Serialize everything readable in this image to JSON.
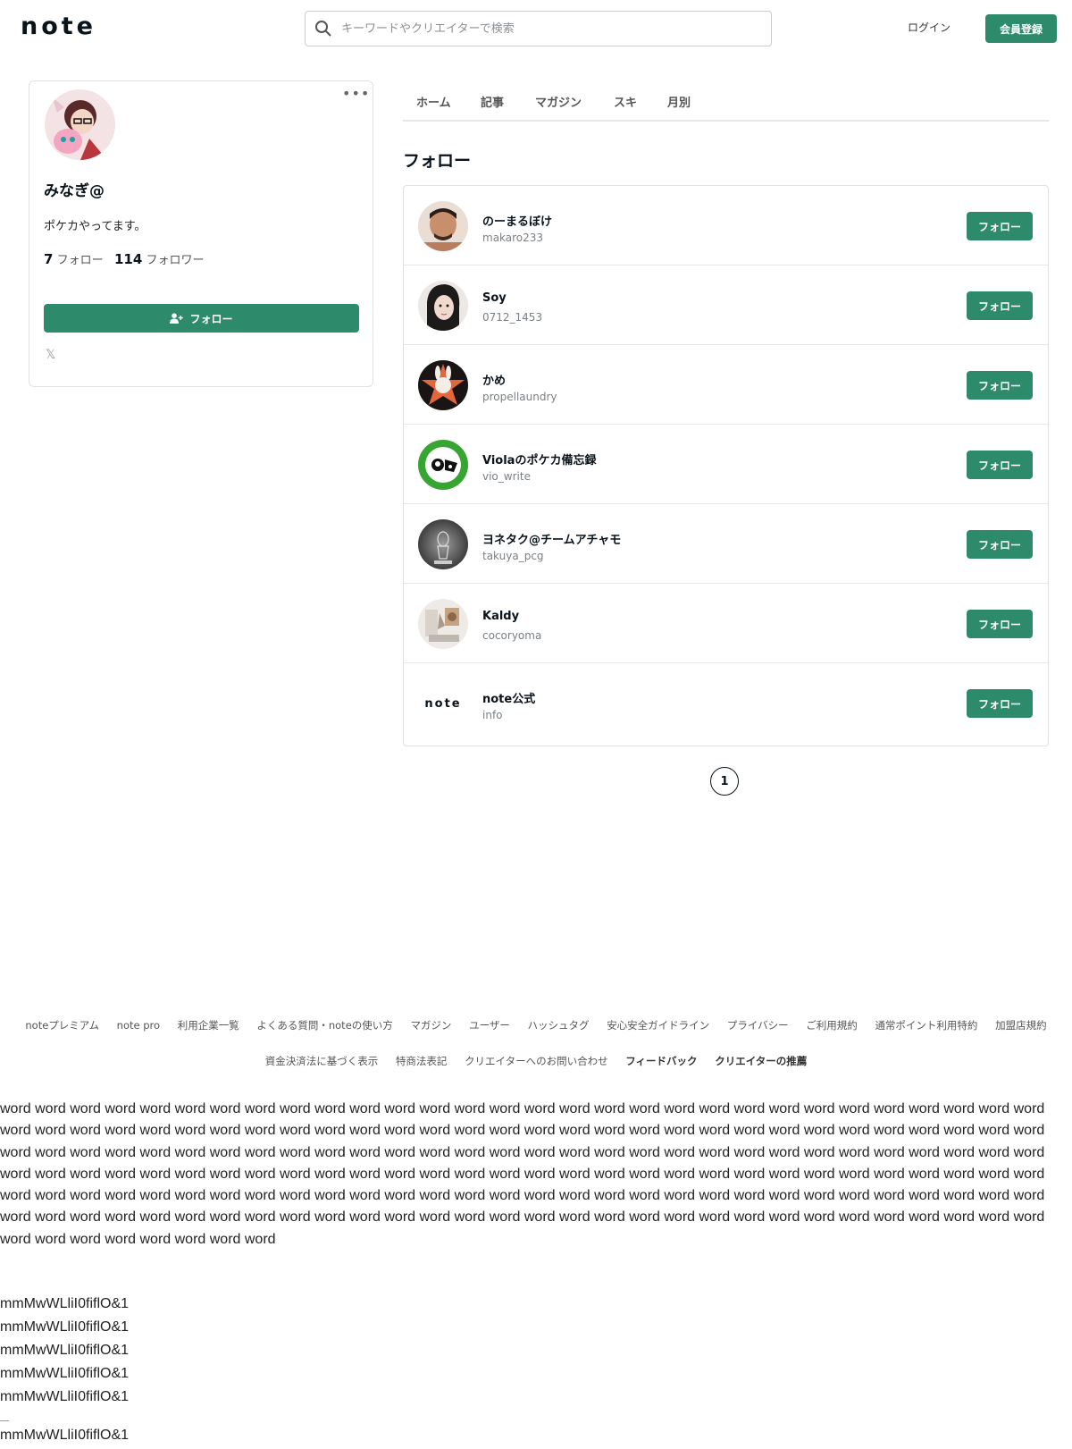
{
  "header": {
    "logo": "note",
    "search_placeholder": "キーワードやクリエイターで検索",
    "login_label": "ログイン",
    "signup_label": "会員登録"
  },
  "profile": {
    "name": "みなぎ@",
    "bio": "ポケカやってます。",
    "following_count": "7",
    "following_label": "フォロー",
    "follower_count": "114",
    "follower_label": "フォロワー",
    "follow_button": "フォロー",
    "more_label": "•••",
    "x_icon": "𝕏"
  },
  "tabs": [
    "ホーム",
    "記事",
    "マガジン",
    "スキ",
    "月別"
  ],
  "section_title": "フォロー",
  "users": [
    {
      "name": "のーまるぼけ",
      "id": "makaro233",
      "button": "フォロー"
    },
    {
      "name": "Soy",
      "id": "0712_1453",
      "button": "フォロー"
    },
    {
      "name": "かめ",
      "id": "propellaundry",
      "button": "フォロー"
    },
    {
      "name": "Violaのポケカ備忘録",
      "id": "vio_write",
      "button": "フォロー"
    },
    {
      "name": "ヨネタク@チームアチャモ",
      "id": "takuya_pcg",
      "button": "フォロー"
    },
    {
      "name": "Kaldy",
      "id": "cocoryoma",
      "button": "フォロー"
    },
    {
      "name": "note公式",
      "id": "info",
      "button": "フォロー"
    }
  ],
  "note_avatar_text": "note",
  "pagination": {
    "current": "1"
  },
  "footer": {
    "row1": [
      "noteプレミアム",
      "note pro",
      "利用企業一覧",
      "よくある質問・noteの使い方",
      "マガジン",
      "ユーザー",
      "ハッシュタグ",
      "安心安全ガイドライン",
      "プライバシー",
      "ご利用規約",
      "通常ポイント利用特約",
      "加盟店規約"
    ],
    "row2": [
      "資金決済法に基づく表示",
      "特商法表記",
      "クリエイターへのお問い合わせ"
    ],
    "row2_bold": [
      "フィードバック",
      "クリエイターの推薦"
    ]
  },
  "filler_text": "word word word word word word word word word word word word word word word word word word word word word word word word word word word word word word word word word word word word word word word word word word word word word word word word word word word word word word word word word word word word word word word word word word word word word word word word word word word word word word word word word word word word word word word word word word word word word word word word word word word word word word word word word word word word word word word word word word word word word word word word word word word word word word word word word word word word word word word word word word word word word word word word word word word word word word word word word word word word word word word word word word word word word word word word word word word word word word word word word word word word word word word word word word word word",
  "glyph_lines": [
    "mmMwWLliI0fiflO&1",
    "mmMwWLliI0fiflO&1",
    "mmMwWLliI0fiflO&1",
    "mmMwWLliI0fiflO&1",
    "mmMwWLliI0fiflO&1"
  ],
  "last_line": "mmMwWLliI0fiflO&1"
}
